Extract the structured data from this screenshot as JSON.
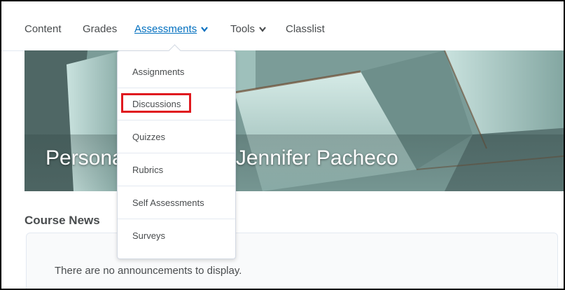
{
  "navbar": {
    "items": [
      {
        "label": "Content"
      },
      {
        "label": "Grades"
      },
      {
        "label": "Assessments"
      },
      {
        "label": "Tools"
      },
      {
        "label": "Classlist"
      }
    ]
  },
  "dropdown": {
    "items": [
      {
        "label": "Assignments"
      },
      {
        "label": "Discussions"
      },
      {
        "label": "Quizzes"
      },
      {
        "label": "Rubrics"
      },
      {
        "label": "Self Assessments"
      },
      {
        "label": "Surveys"
      }
    ],
    "highlighted_item": "Discussions",
    "highlight_color": "#e0191f"
  },
  "banner": {
    "title": "Personal Sandbox - Jennifer Pacheco"
  },
  "course_news": {
    "heading": "Course News",
    "empty_message": "There are no announcements to display."
  },
  "colors": {
    "accent": "#006fbf",
    "text": "#494c4e"
  }
}
